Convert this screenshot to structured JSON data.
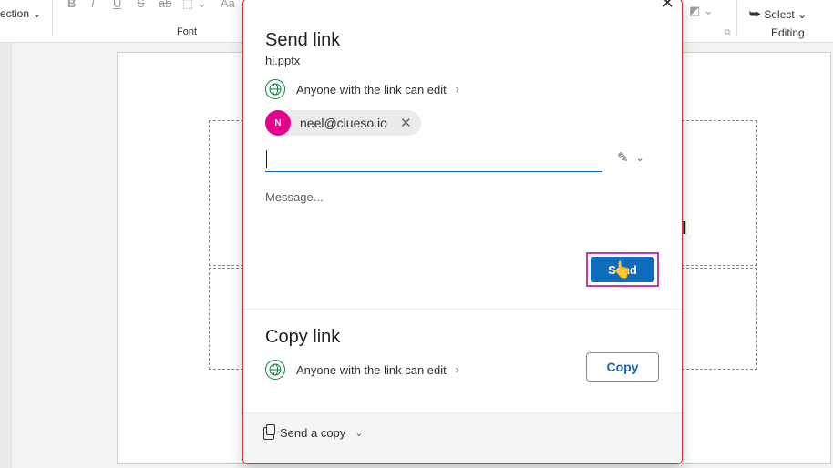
{
  "ribbon": {
    "section_label": "ection",
    "font_group_label": "Font",
    "select_label": "Select",
    "editing_group_label": "Editing"
  },
  "dialog": {
    "send_link_title": "Send link",
    "file_name": "hi.pptx",
    "permission_text": "Anyone with the link can edit",
    "recipient_initial": "N",
    "recipient_email": "neel@clueso.io",
    "to_input_value": "",
    "message_placeholder": "Message...",
    "send_label": "Send",
    "copy_link_title": "Copy link",
    "copy_permission_text": "Anyone with the link can edit",
    "copy_label": "Copy",
    "send_copy_label": "Send a copy"
  },
  "colors": {
    "accent": "#0f6cbd",
    "avatar": "#e3008c",
    "globe": "#107c41",
    "highlight": "#c239b3"
  }
}
